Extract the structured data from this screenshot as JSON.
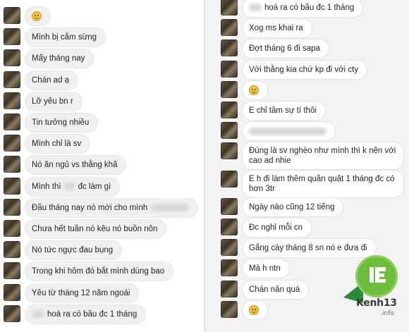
{
  "left_messages": [
    {
      "type": "emoji",
      "text": "",
      "emoji": "smile"
    },
    {
      "type": "text",
      "text": "Mình bị cắm sừng"
    },
    {
      "type": "text",
      "text": "Mấy tháng nay"
    },
    {
      "type": "text",
      "text": "Chán ad ạ"
    },
    {
      "type": "text",
      "text": "Lỡ yêu bn r"
    },
    {
      "type": "text",
      "text": "Tin tưởng nhiều"
    },
    {
      "type": "text",
      "text": "Mình chỉ là sv"
    },
    {
      "type": "text",
      "text": "Nó ăn ngủ vs thằng khã"
    },
    {
      "type": "text",
      "text": "Mình thì",
      "after": "đc làm gì",
      "redacted": true
    },
    {
      "type": "text",
      "text": "Đầu tháng nay nó mới cho mình",
      "redacted_tail": true
    },
    {
      "type": "text",
      "text": "Chưa hết tuần nó kêu nó buồn nôn"
    },
    {
      "type": "text",
      "text": "Nó tức ngực đau bụng"
    },
    {
      "type": "text",
      "text": "Trong khi hôm đó bắt mình dùng bao"
    },
    {
      "type": "text",
      "text": "Yêu từ tháng 12 năm ngoái"
    },
    {
      "type": "text",
      "text": "hoá ra có bầu đc 1 tháng",
      "redacted_head": true
    }
  ],
  "right_messages": [
    {
      "type": "text",
      "text": "hoá ra có bầu đc 1 tháng",
      "redacted_head": true
    },
    {
      "type": "text",
      "text": "Xog ms khai ra"
    },
    {
      "type": "text",
      "text": "Đợt tháng 6 đi sapa"
    },
    {
      "type": "text",
      "text": "Với thằng kia chứ kp đi với cty"
    },
    {
      "type": "emoji",
      "text": "",
      "emoji": "smile"
    },
    {
      "type": "text",
      "text": "E chỉ tâm sự tí thôi"
    },
    {
      "type": "blur",
      "text": ""
    },
    {
      "type": "multi",
      "text": "Đúng là sv nghèo như mình thì k nên với cao ad nhie"
    },
    {
      "type": "multi",
      "text": "E h đi làm thêm quần quật 1 tháng đc có hơn 3tr"
    },
    {
      "type": "text",
      "text": "Ngày nào cũng 12 tiếng"
    },
    {
      "type": "text",
      "text": "Đc nghỉ mỗi cn"
    },
    {
      "type": "text",
      "text": "Gắng cày tháng 8 sn nó e đưa đi"
    },
    {
      "type": "text",
      "text": "Mà h ntn"
    },
    {
      "type": "text",
      "text": "Chán nản quá"
    },
    {
      "type": "emoji",
      "text": "",
      "emoji": "smile"
    }
  ],
  "watermark": {
    "brand": "Kenh13",
    "sub": ".info",
    "accent": "#6cbd3a"
  }
}
